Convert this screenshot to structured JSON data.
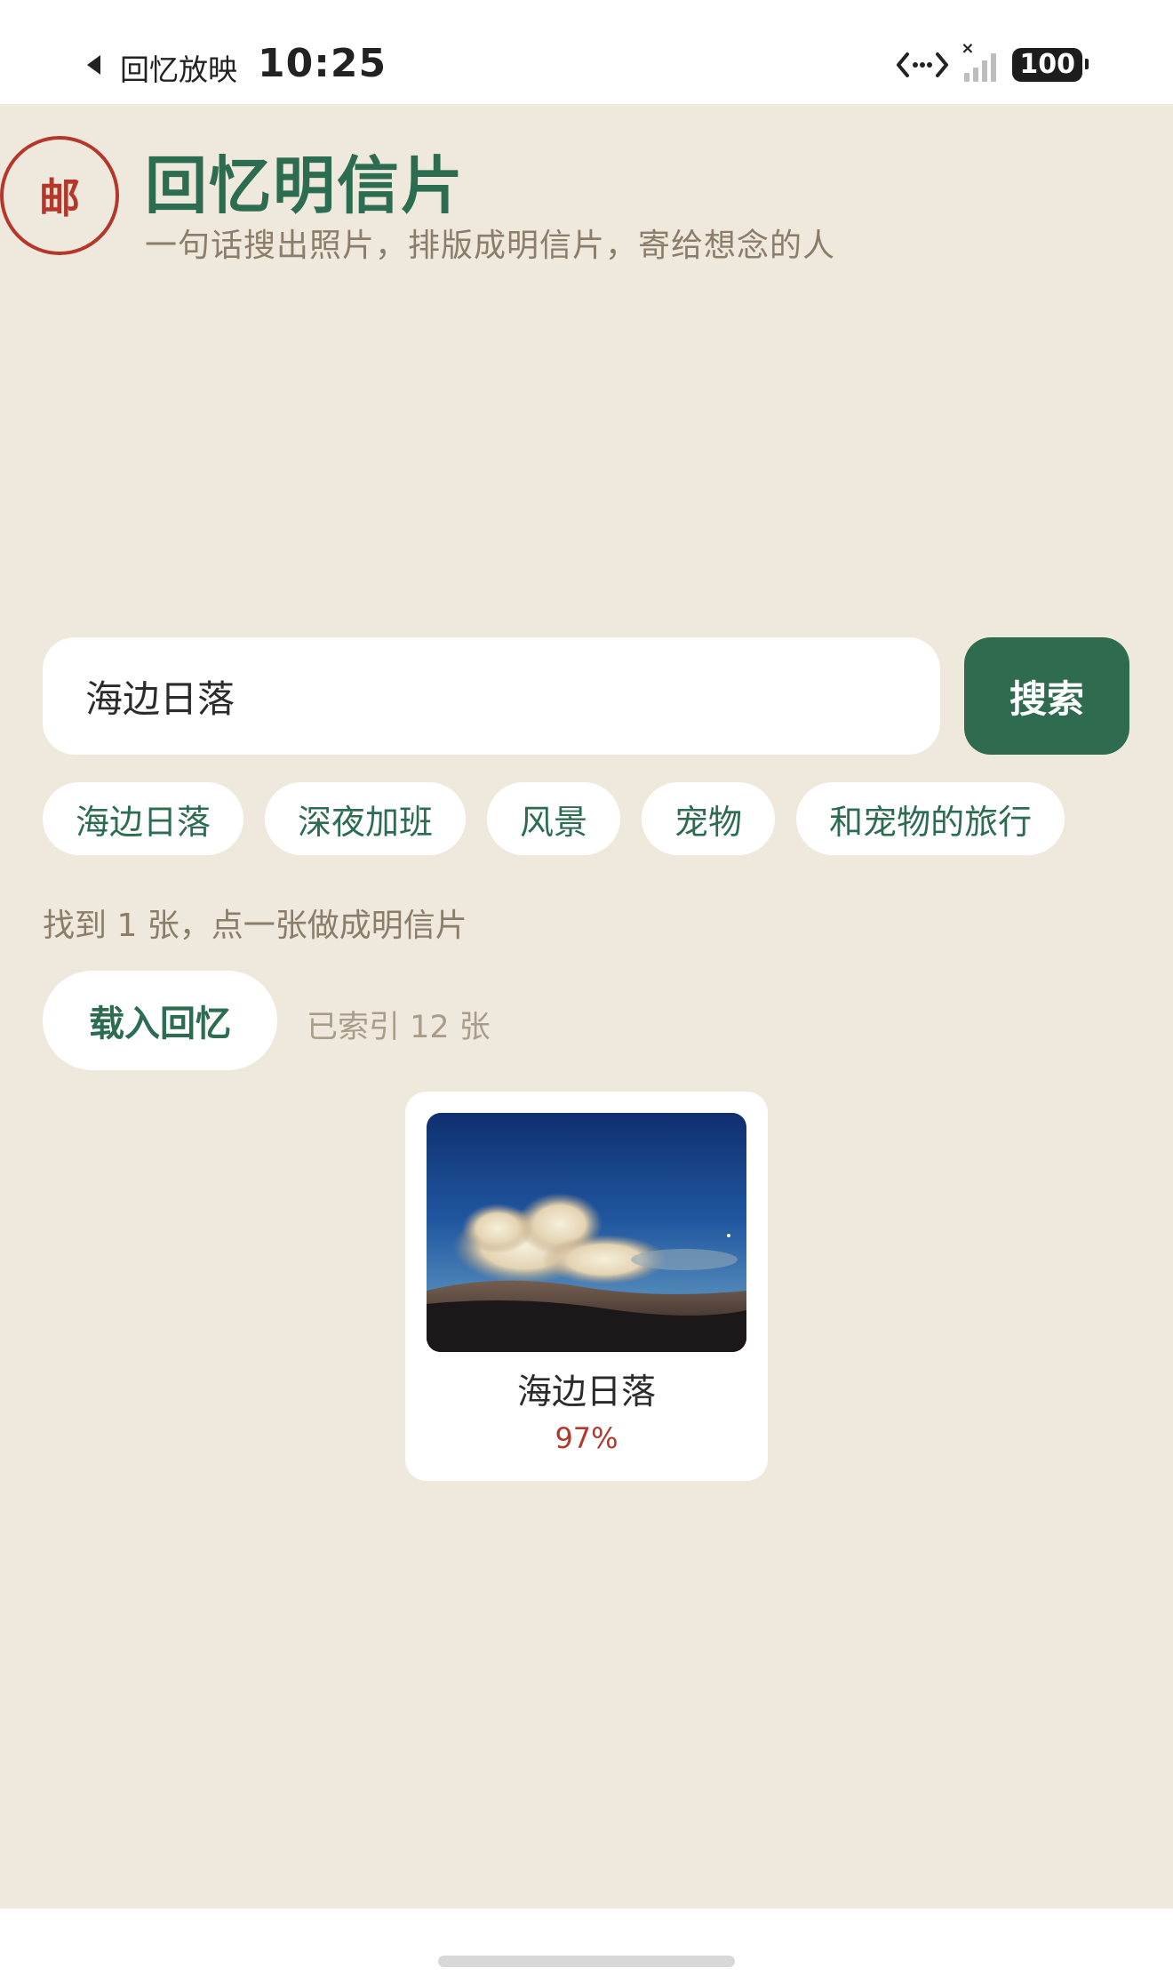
{
  "status_bar": {
    "back_app": "回忆放映",
    "time": "10:25",
    "battery": "100"
  },
  "header": {
    "stamp_text": "邮",
    "title": "回忆明信片",
    "subtitle": "一句话搜出照片，排版成明信片，寄给想念的人"
  },
  "search": {
    "value": "海边日落",
    "button_label": "搜索"
  },
  "suggestions": [
    "海边日落",
    "深夜加班",
    "风景",
    "宠物",
    "和宠物的旅行"
  ],
  "results": {
    "summary": "找到 1 张，点一张做成明信片",
    "load_label": "载入回忆",
    "indexed_text": "已索引 12 张",
    "items": [
      {
        "title": "海边日落",
        "score": "97%"
      }
    ]
  },
  "colors": {
    "background": "#efe8dc",
    "accent_green": "#2e6b4f",
    "stamp_red": "#b5372a",
    "muted_text": "#8a7d6a"
  },
  "icons": [
    "back-arrow-icon",
    "data-transfer-icon",
    "signal-icon",
    "battery-icon",
    "postal-stamp-icon"
  ]
}
